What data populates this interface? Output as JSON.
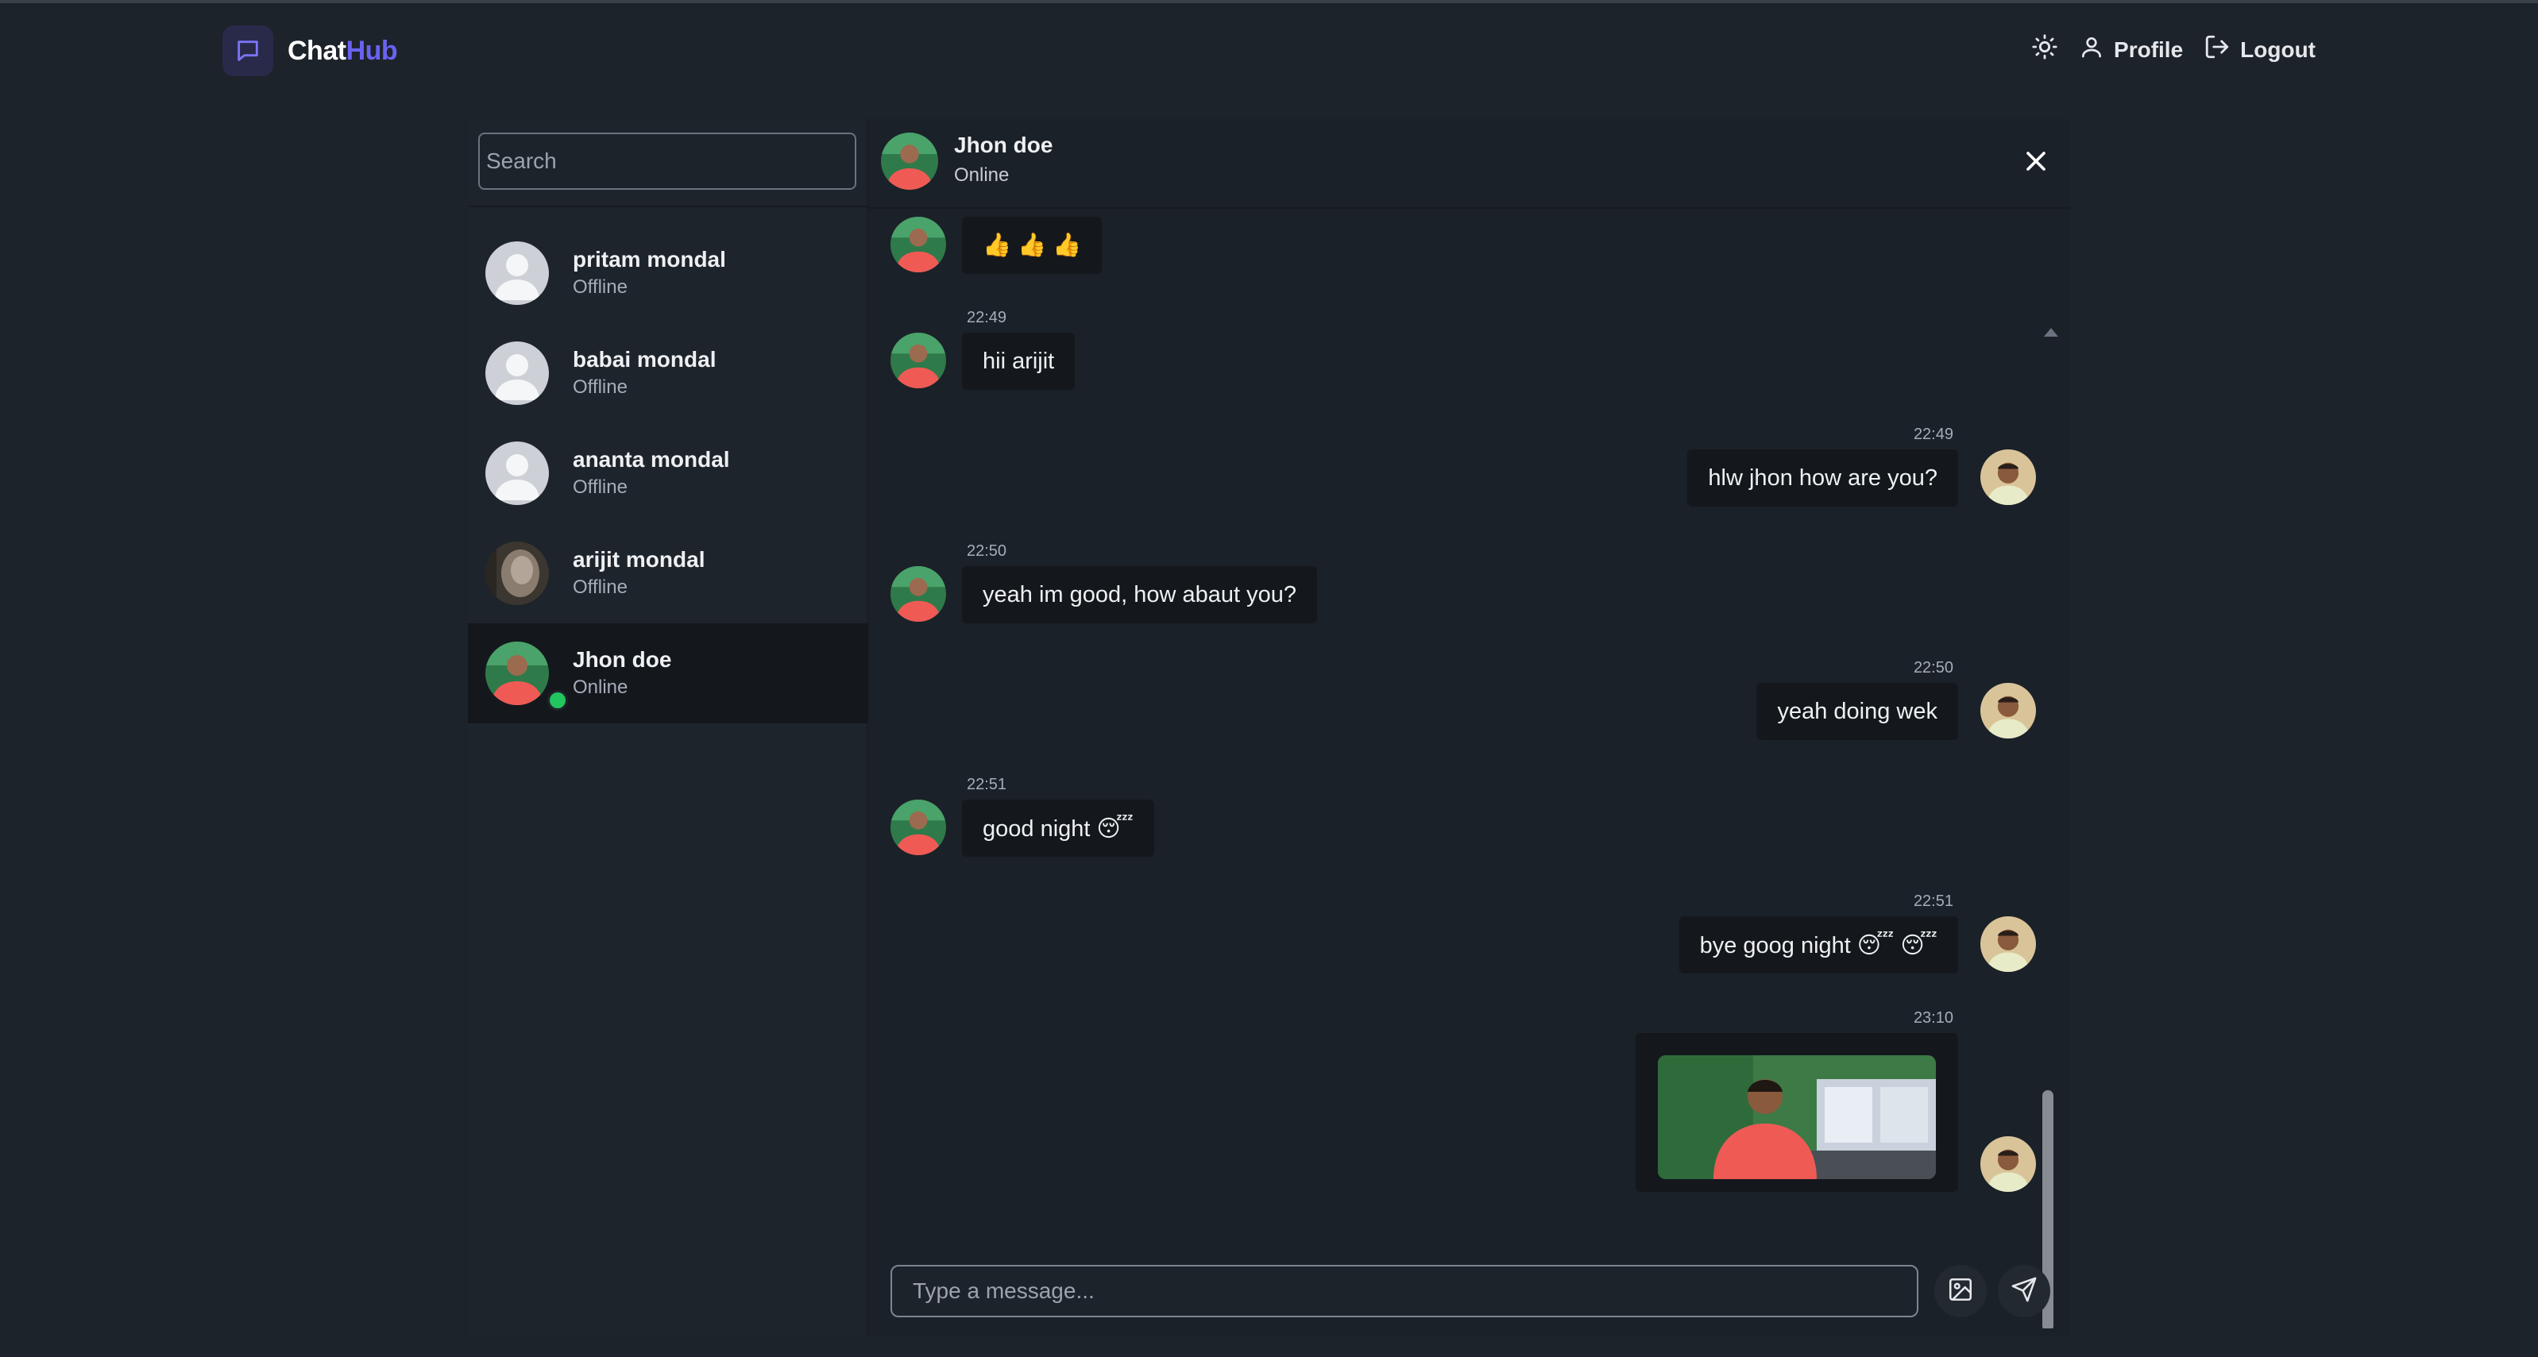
{
  "app": {
    "brand_prefix": "Chat",
    "brand_accent": "Hub",
    "accent_color": "#6a62f0",
    "online_color": "#22c55e"
  },
  "navbar": {
    "theme_toggle_icon": "sun-icon",
    "profile_label": "Profile",
    "logout_label": "Logout"
  },
  "sidebar": {
    "search_placeholder": "Search",
    "contacts": [
      {
        "name": "pritam mondal",
        "status": "Offline",
        "avatar": "default-avatar"
      },
      {
        "name": "babai mondal",
        "status": "Offline",
        "avatar": "default-avatar"
      },
      {
        "name": "ananta mondal",
        "status": "Offline",
        "avatar": "default-avatar"
      },
      {
        "name": "arijit mondal",
        "status": "Offline",
        "avatar": "photo-avatar"
      },
      {
        "name": "Jhon doe",
        "status": "Online",
        "avatar": "photo-avatar",
        "selected": true
      }
    ]
  },
  "chat": {
    "header": {
      "name": "Jhon doe",
      "status": "Online"
    },
    "messages": [
      {
        "from": "them",
        "time": "",
        "text": "👍 👍 👍"
      },
      {
        "from": "them",
        "time": "22:49",
        "text": "hii arijit"
      },
      {
        "from": "me",
        "time": "22:49",
        "text": "hlw jhon how are you?"
      },
      {
        "from": "them",
        "time": "22:50",
        "text": "yeah im good, how abaut you?"
      },
      {
        "from": "me",
        "time": "22:50",
        "text": "yeah doing wek"
      },
      {
        "from": "them",
        "time": "22:51",
        "text": "good night 😴"
      },
      {
        "from": "me",
        "time": "22:51",
        "text": "bye goog night 😴 😴"
      },
      {
        "from": "me",
        "time": "23:10",
        "text": "",
        "attachment": "image"
      }
    ],
    "composer": {
      "placeholder": "Type a message..."
    }
  }
}
